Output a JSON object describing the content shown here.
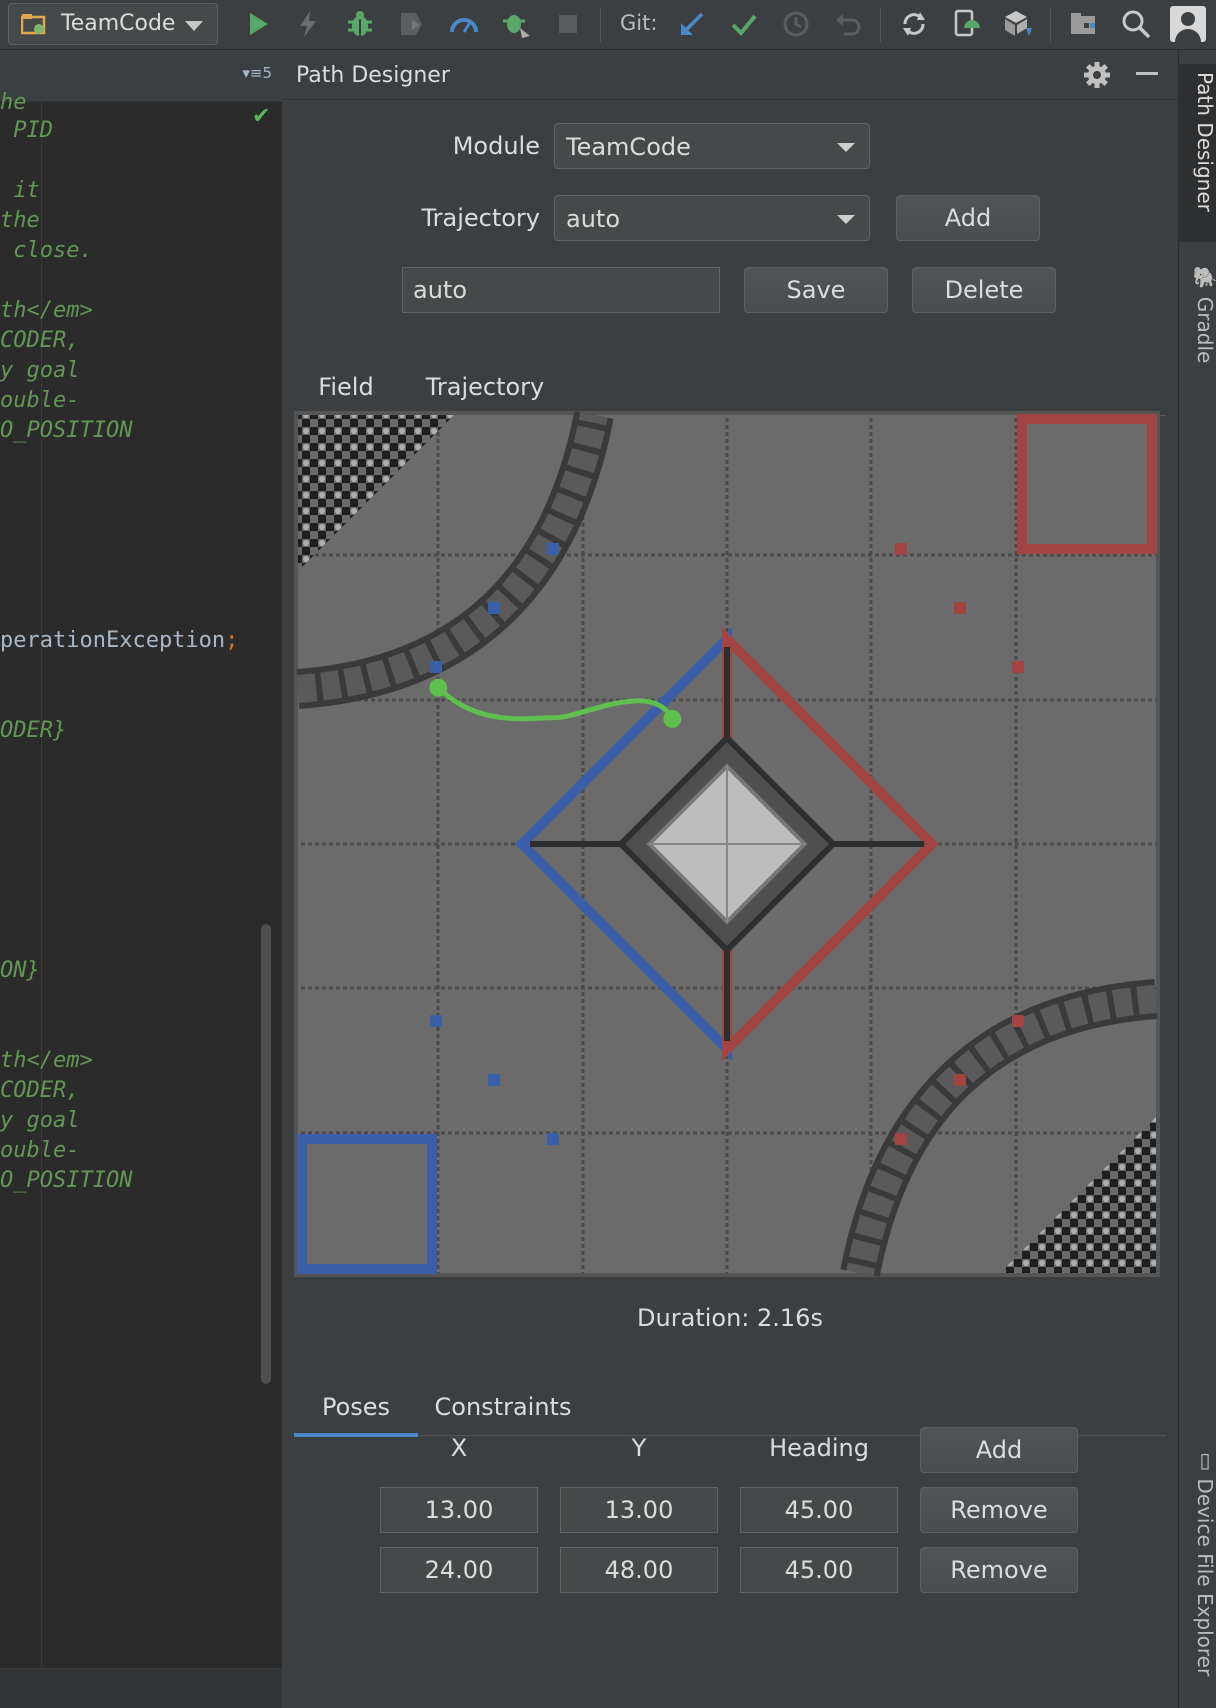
{
  "toolbar": {
    "run_config": "TeamCode",
    "git_label": "Git:"
  },
  "editor": {
    "toolbar_count": "5",
    "lines": [
      "he",
      " PID",
      "",
      " it",
      "the",
      " close.",
      "",
      "th</em>",
      "CODER,",
      "y goal",
      "ouble-",
      "O_POSITION",
      "perationException",
      "ODER}",
      "ON}",
      "th</em>",
      "CODER,",
      "y goal",
      "ouble-",
      "O_POSITION"
    ],
    "semicolon": ";"
  },
  "panel": {
    "title": "Path Designer",
    "module_label": "Module",
    "module_value": "TeamCode",
    "trajectory_label": "Trajectory",
    "trajectory_value": "auto",
    "add_label": "Add",
    "name_value": "auto",
    "save_label": "Save",
    "delete_label": "Delete",
    "view_tabs": [
      {
        "label": "Field",
        "selected": true
      },
      {
        "label": "Trajectory",
        "selected": false
      }
    ],
    "duration": "Duration: 2.16s",
    "editor_tabs": [
      {
        "label": "Poses",
        "selected": true
      },
      {
        "label": "Constraints",
        "selected": false
      }
    ],
    "table": {
      "headers": [
        "X",
        "Y",
        "Heading"
      ],
      "add_label": "Add",
      "remove_label": "Remove",
      "rows": [
        {
          "x": "13.00",
          "y": "13.00",
          "heading": "45.00"
        },
        {
          "x": "24.00",
          "y": "48.00",
          "heading": "45.00"
        }
      ]
    }
  },
  "side_tabs": {
    "path_designer": "Path Designer",
    "gradle": "Gradle",
    "device_file_explorer": "Device File Explorer"
  },
  "colors": {
    "path": "#5fbf4f",
    "blue_alliance": "#3a5fa8",
    "red_alliance": "#a34444",
    "accent": "#4a88c7"
  }
}
